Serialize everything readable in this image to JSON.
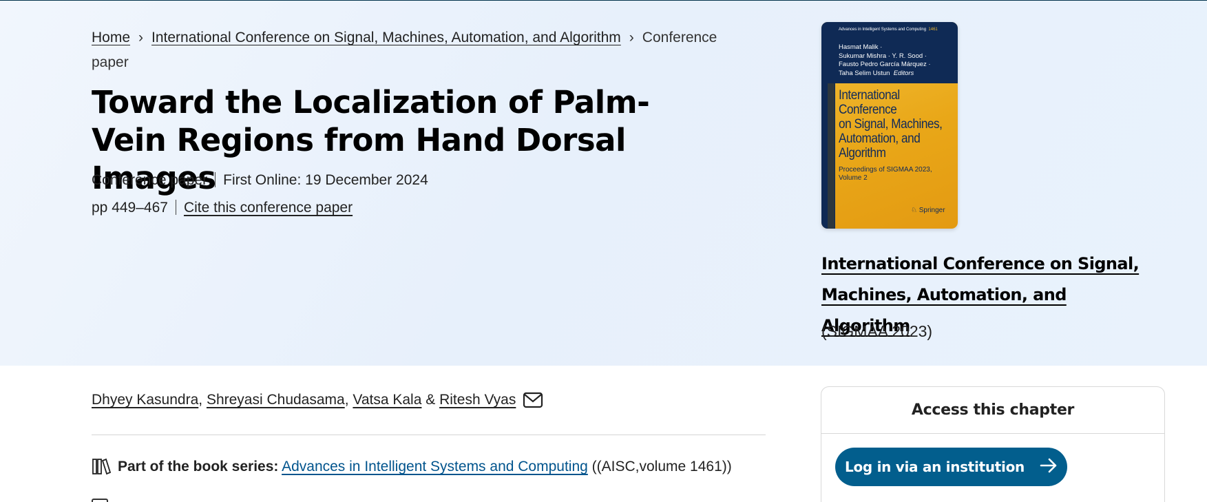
{
  "breadcrumb": {
    "home": "Home",
    "conference": "International Conference on Signal, Machines, Automation, and Algorithm",
    "current": "Conference paper"
  },
  "paper": {
    "title": "Toward the Localization of Palm-Vein Regions from Hand Dorsal Images",
    "type": "Conference paper",
    "first_online": "First Online: 19 December 2024",
    "pages": "pp 449–467",
    "cite_label": "Cite this conference paper"
  },
  "cover": {
    "series": "Advances in Intelligent Systems and Computing",
    "volume": "1461",
    "editors": [
      "Hasmat Malik ·",
      "Sukumar Mishra · Y. R. Sood ·",
      "Fausto Pedro García Márquez ·",
      "Taha Selim Ustun"
    ],
    "editors_suffix": "Editors",
    "title_lines": [
      "International",
      "Conference",
      "on Signal, Machines,",
      "Automation, and",
      "Algorithm"
    ],
    "subtitle_lines": [
      "Proceedings of SIGMAA 2023,",
      "Volume 2"
    ],
    "publisher": "Springer"
  },
  "conference": {
    "name": "International Conference on Signal, Machines, Automation, and Algorithm",
    "acronym": "(SIGMAA 2023)"
  },
  "authors": {
    "list": [
      "Dhyey Kasundra",
      "Shreyasi Chudasama",
      "Vatsa Kala",
      "Ritesh Vyas"
    ],
    "sep1": ", ",
    "sep2": ", ",
    "sep3": " & "
  },
  "book_series": {
    "label": "Part of the book series:",
    "name": "Advances in Intelligent Systems and Computing",
    "suffix": "((AISC,volume 1461))"
  },
  "access": {
    "heading": "Access this chapter",
    "login_label": "Log in via an institution"
  },
  "colors": {
    "hero_bg": "#e9f1fc",
    "brand_blue": "#025e8d",
    "cover_navy": "#0f2a55",
    "cover_gold": "#e9a718"
  }
}
